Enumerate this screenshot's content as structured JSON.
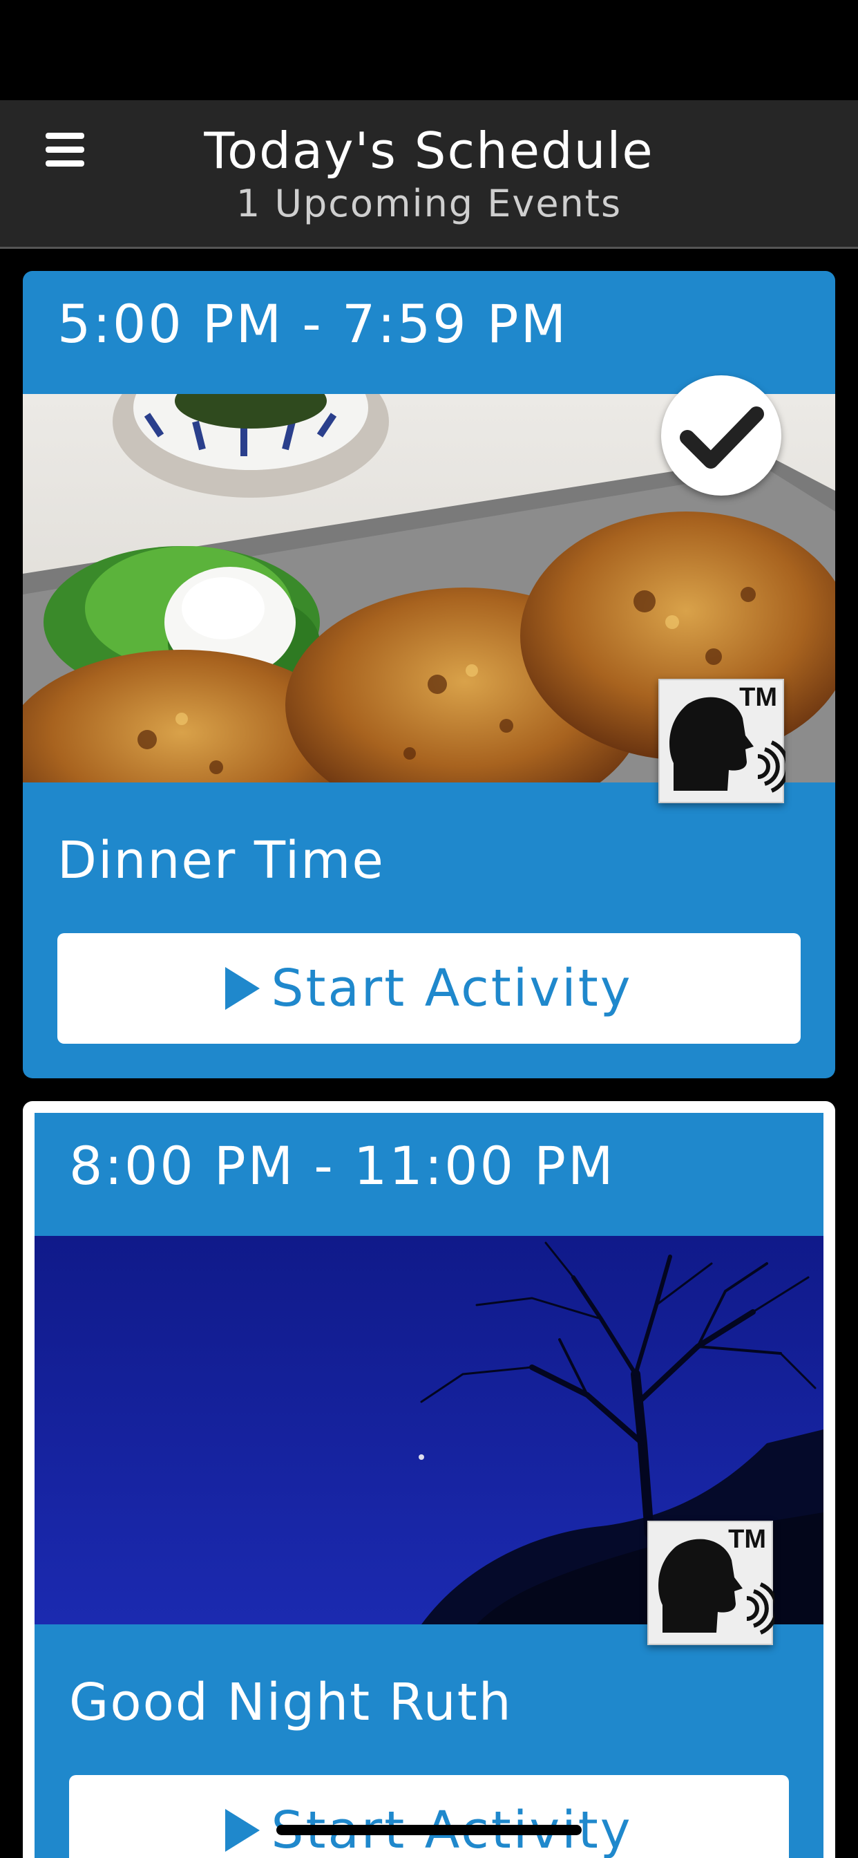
{
  "header": {
    "title": "Today's Schedule",
    "subtitle": "1 Upcoming Events",
    "menu_icon": "hamburger-menu-icon"
  },
  "events": [
    {
      "time": "5:00 PM - 7:59 PM",
      "title": "Dinner Time",
      "image": "grilled-patties-dinner-photo",
      "completed": true,
      "button_label": "Start Activity"
    },
    {
      "time": "8:00 PM - 11:00 PM",
      "title": "Good Night Ruth",
      "image": "night-sky-tree-photo",
      "completed": false,
      "button_label": "Start Activity"
    }
  ],
  "speak_badge": "TM",
  "colors": {
    "card_blue": "#1f88cc",
    "header_bg": "#262626",
    "background": "#000000"
  }
}
